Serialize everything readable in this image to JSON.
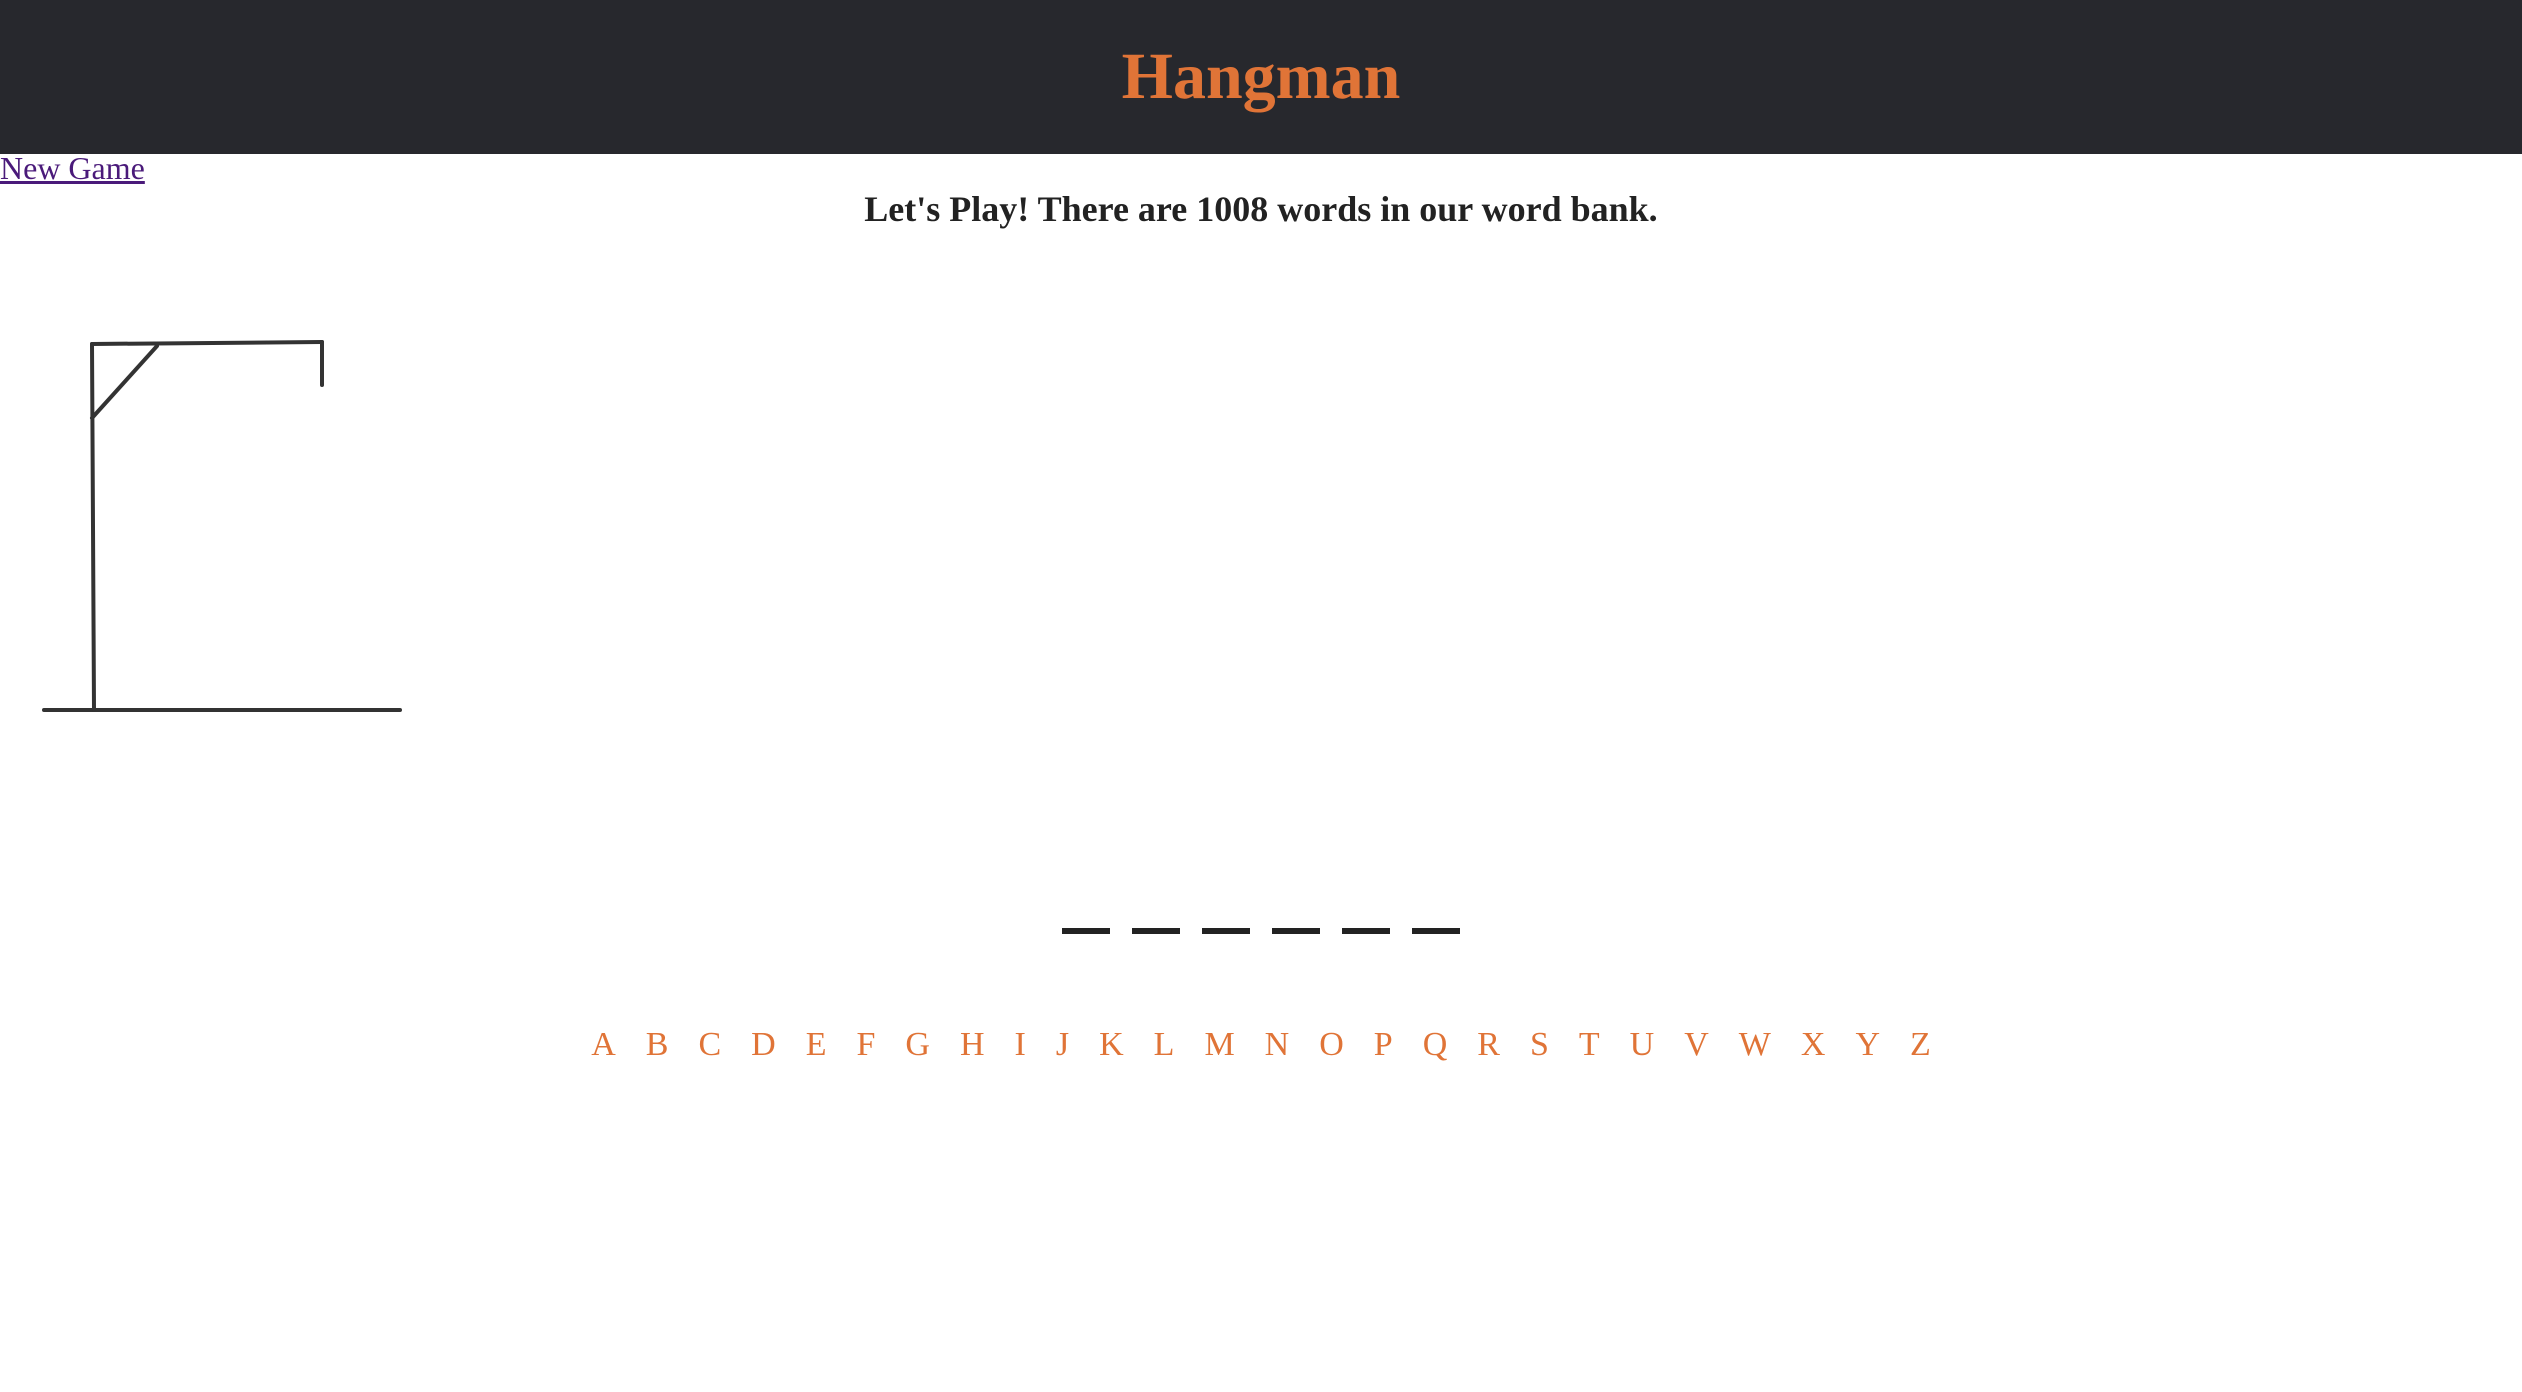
{
  "header": {
    "title": "Hangman"
  },
  "nav": {
    "new_game_label": "New Game"
  },
  "status": {
    "message": "Let's Play! There are 1008 words in our word bank."
  },
  "game": {
    "word_blanks": [
      "",
      "",
      "",
      "",
      "",
      ""
    ],
    "letters": [
      "A",
      "B",
      "C",
      "D",
      "E",
      "F",
      "G",
      "H",
      "I",
      "J",
      "K",
      "L",
      "M",
      "N",
      "O",
      "P",
      "Q",
      "R",
      "S",
      "T",
      "U",
      "V",
      "W",
      "X",
      "Y",
      "Z"
    ]
  },
  "colors": {
    "header_bg": "#27282d",
    "accent": "#e07437",
    "text": "#222222",
    "link": "#4a1a7a"
  }
}
